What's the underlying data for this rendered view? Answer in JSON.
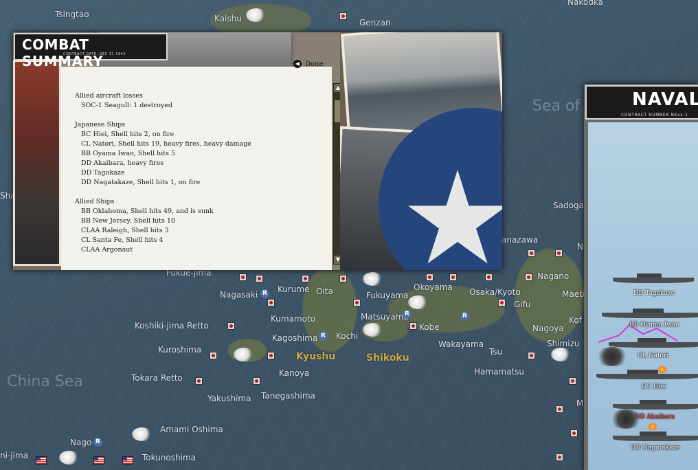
{
  "map": {
    "labels": [
      {
        "id": "tsingtao",
        "text": "Tsingtao"
      },
      {
        "id": "kaishu",
        "text": "Kaishu"
      },
      {
        "id": "genzan",
        "text": "Genzan"
      },
      {
        "id": "nakodka",
        "text": "Nakodka"
      },
      {
        "id": "sadoga",
        "text": "Sadoga"
      },
      {
        "id": "fukue-jima",
        "text": "Fukue-jima"
      },
      {
        "id": "nagasaki",
        "text": "Nagasaki"
      },
      {
        "id": "kurume",
        "text": "Kurume"
      },
      {
        "id": "oita",
        "text": "Oita"
      },
      {
        "id": "fukuyama",
        "text": "Fukuyama"
      },
      {
        "id": "okoyama",
        "text": "Okoyama"
      },
      {
        "id": "osaka-kyoto",
        "text": "Osaka/Kyoto"
      },
      {
        "id": "gifu",
        "text": "Gifu"
      },
      {
        "id": "nagano",
        "text": "Nagano"
      },
      {
        "id": "maeba",
        "text": "Maeba"
      },
      {
        "id": "kumamoto",
        "text": "Kumamoto"
      },
      {
        "id": "matsuyama",
        "text": "Matsuyama"
      },
      {
        "id": "kobe",
        "text": "Kobe"
      },
      {
        "id": "nagoya",
        "text": "Nagoya"
      },
      {
        "id": "koshiki-jima-retto",
        "text": "Koshiki-jima Retto"
      },
      {
        "id": "kagoshima",
        "text": "Kagoshima"
      },
      {
        "id": "kochi",
        "text": "Kochi"
      },
      {
        "id": "wakayama",
        "text": "Wakayama"
      },
      {
        "id": "shimizu",
        "text": "Shimizu"
      },
      {
        "id": "kuroshima",
        "text": "Kuroshima"
      },
      {
        "id": "tsu",
        "text": "Tsu"
      },
      {
        "id": "hamamatsu",
        "text": "Hamamatsu"
      },
      {
        "id": "kanoya",
        "text": "Kanoya"
      },
      {
        "id": "tokara-retto",
        "text": "Tokara Retto"
      },
      {
        "id": "yakushima",
        "text": "Yakushima"
      },
      {
        "id": "tanegashima",
        "text": "Tanegashima"
      },
      {
        "id": "amami-oshima",
        "text": "Amami Oshima"
      },
      {
        "id": "nago",
        "text": "Nago"
      },
      {
        "id": "tokunoshima",
        "text": "Tokunoshima"
      },
      {
        "id": "ni-jima",
        "text": "ni-jima"
      },
      {
        "id": "anazawa",
        "text": "anazawa"
      },
      {
        "id": "sha",
        "text": "Sha"
      },
      {
        "id": "mi",
        "text": "Mi"
      },
      {
        "id": "n-right",
        "text": "N"
      },
      {
        "id": "kof",
        "text": "Kof"
      }
    ],
    "seas": [
      {
        "id": "china-sea",
        "text": "China Sea"
      },
      {
        "id": "sea-of",
        "text": "Sea of"
      }
    ],
    "regions": [
      {
        "id": "kyushu",
        "text": "Kyushu"
      },
      {
        "id": "shikoku",
        "text": "Shikoku"
      }
    ],
    "r_marker": "R"
  },
  "combat_summary": {
    "title": "COMBAT SUMMARY",
    "subtitle": "CONTRACT DATE: DEC 31 1943",
    "done_label": "Done",
    "sections": [
      {
        "heading": "Allied aircraft losses",
        "items": [
          "SOC-1 Seagull: 1 destroyed"
        ]
      },
      {
        "heading": "Japanese Ships",
        "items": [
          "BC Hiei, Shell hits 2,  on fire",
          "CL Natori, Shell hits 19,  heavy fires,  heavy damage",
          "BB Oyama Iwao, Shell hits 5",
          "DD Akaibara,  heavy fires",
          "DD Tagokaze",
          "DD Nagatakaze, Shell hits 1,  on fire"
        ]
      },
      {
        "heading": "Allied Ships",
        "items": [
          "BB Oklahoma, Shell hits 49, and is sunk",
          "BB New Jersey, Shell hits 10",
          "CLAA Raleigh, Shell hits 3",
          "CL Santa Fe, Shell hits 4",
          "CLAA Argonaut"
        ]
      }
    ]
  },
  "naval_panel": {
    "title": "NAVAL",
    "subtitle": "CONTRACT NUMBER   NKxx-1",
    "ships": [
      {
        "name": "DD Tagokaze",
        "hit": false
      },
      {
        "name": "BB Oyama Iwao",
        "hit": false
      },
      {
        "name": "CL Natori",
        "hit": false
      },
      {
        "name": "BC Hiei",
        "hit": false
      },
      {
        "name": "DD Akaibara",
        "hit": true
      },
      {
        "name": "DD Nagatakaze",
        "hit": false
      }
    ]
  },
  "colors": {
    "accent": "#c9a94a",
    "hit_text": "#ff3030",
    "sea": "#3f5568"
  }
}
